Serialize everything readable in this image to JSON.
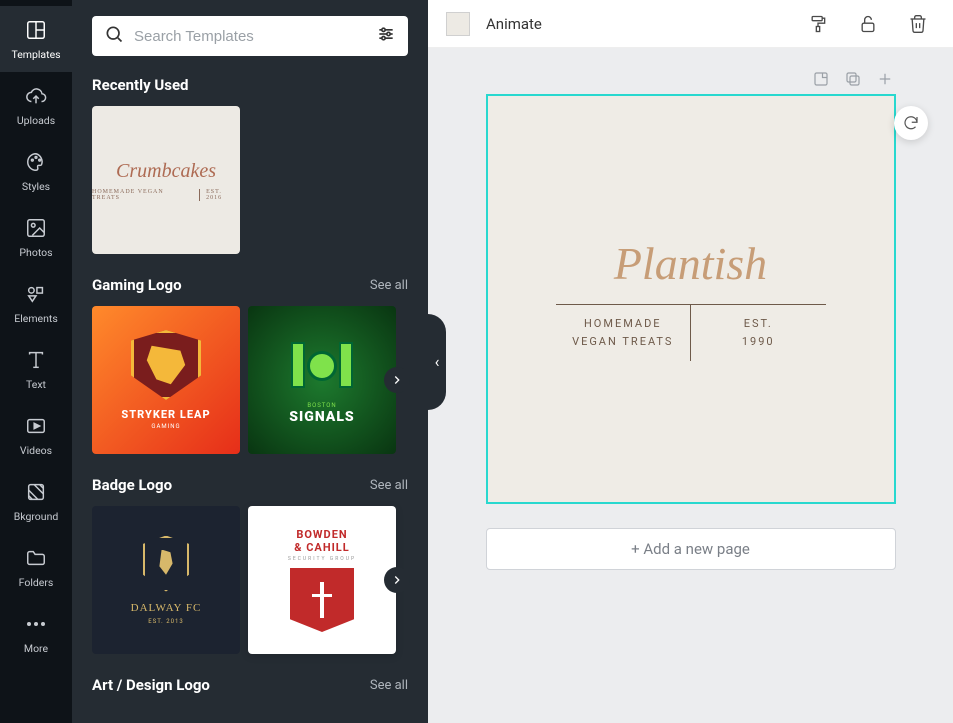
{
  "rail": {
    "items": [
      {
        "label": "Templates"
      },
      {
        "label": "Uploads"
      },
      {
        "label": "Styles"
      },
      {
        "label": "Photos"
      },
      {
        "label": "Elements"
      },
      {
        "label": "Text"
      },
      {
        "label": "Videos"
      },
      {
        "label": "Bkground"
      },
      {
        "label": "Folders"
      },
      {
        "label": "More"
      }
    ]
  },
  "search": {
    "placeholder": "Search Templates"
  },
  "sections": {
    "recent": {
      "title": "Recently Used"
    },
    "gaming": {
      "title": "Gaming Logo",
      "see_all": "See all"
    },
    "badge": {
      "title": "Badge Logo",
      "see_all": "See all"
    },
    "art": {
      "title": "Art / Design Logo",
      "see_all": "See all"
    }
  },
  "thumbs": {
    "crumb": {
      "brand": "Crumbcakes",
      "sub_left": "HOMEMADE VEGAN TREATS",
      "sub_right": "EST. 2016"
    },
    "stryker": {
      "t1": "STRYKER LEAP",
      "t2": "GAMING"
    },
    "signals": {
      "city": "BOSTON",
      "t1": "SIGNALS"
    },
    "dalway": {
      "t1": "DALWAY FC",
      "t2": "EST. 2013"
    },
    "bowden": {
      "t1a": "BOWDEN",
      "t1b": "& CAHILL",
      "t2": "SECURITY GROUP"
    }
  },
  "topbar": {
    "animate": "Animate"
  },
  "page": {
    "brand": "Plantish",
    "left1": "HOMEMADE",
    "left2": "VEGAN TREATS",
    "right1": "EST.",
    "right2": "1990"
  },
  "add_page": "+ Add a new page"
}
